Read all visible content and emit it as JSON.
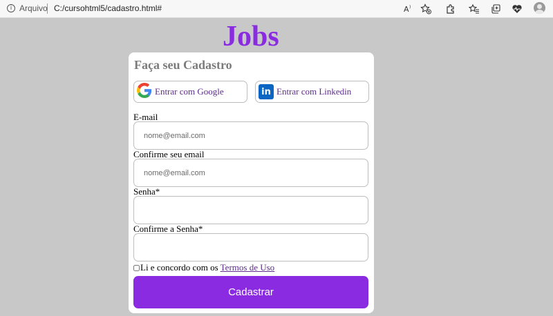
{
  "browser": {
    "site_label": "Arquivo",
    "url": "C:/cursohtml5/cadastro.html#",
    "icons": [
      "info-icon",
      "read-aloud-icon",
      "favorite-add-icon",
      "extensions-icon",
      "favorites-icon",
      "collections-icon",
      "health-icon",
      "profile-avatar"
    ]
  },
  "page": {
    "title": "Jobs"
  },
  "form": {
    "heading": "Faça seu Cadastro",
    "google_label": "Entrar com Google",
    "linkedin_label": "Entrar com Linkedin",
    "linkedin_icon_text": "in",
    "email_label": "E-mail",
    "email_placeholder": "nome@email.com",
    "email_confirm_label": "Confirme seu email",
    "email_confirm_placeholder": "nome@email.com",
    "password_label": "Senha*",
    "password_confirm_label": "Confirme a Senha*",
    "terms_text": "Li e concordo com os",
    "terms_link": "Termos de Uso",
    "submit_label": "Cadastrar"
  },
  "colors": {
    "accent": "#8a2be2",
    "link": "#5b2c8c",
    "background": "#c8c8c8",
    "heading_gray": "#7b7b7b"
  }
}
